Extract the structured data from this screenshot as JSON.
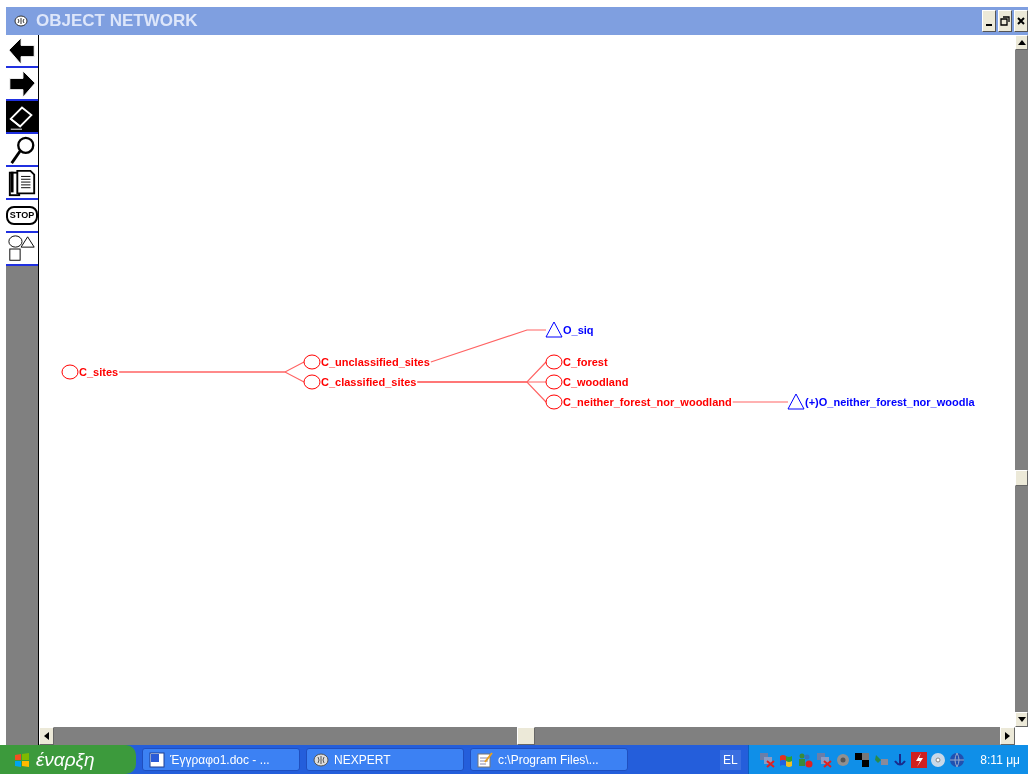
{
  "window": {
    "title": "OBJECT NETWORK"
  },
  "tools": [
    {
      "kind": "back",
      "selected": false
    },
    {
      "kind": "forward",
      "selected": false
    },
    {
      "kind": "eraser",
      "selected": true
    },
    {
      "kind": "magnifier",
      "selected": false
    },
    {
      "kind": "notes",
      "selected": false
    },
    {
      "kind": "stop",
      "label": "STOP",
      "selected": false
    },
    {
      "kind": "shapes",
      "selected": false
    }
  ],
  "network": {
    "root": {
      "kind": "class",
      "label": "C_sites",
      "children": [
        {
          "kind": "class",
          "label": "C_unclassified_sites",
          "children": [
            {
              "kind": "object",
              "label": "O_siq"
            }
          ]
        },
        {
          "kind": "class",
          "label": "C_classified_sites",
          "children": [
            {
              "kind": "class",
              "label": "C_forest"
            },
            {
              "kind": "class",
              "label": "C_woodland"
            },
            {
              "kind": "class",
              "label": "C_neither_forest_nor_woodland",
              "children": [
                {
                  "kind": "object",
                  "label": "(+)O_neither_forest_nor_woodla"
                }
              ]
            }
          ]
        }
      ]
    }
  },
  "taskbar": {
    "start": "έναρξη",
    "tasks": [
      {
        "kind": "word",
        "label": "Έγγραφο1.doc - ..."
      },
      {
        "kind": "app",
        "label": "NEXPERT"
      },
      {
        "kind": "notepad",
        "label": "c:\\Program Files\\..."
      }
    ],
    "language": "EL",
    "time": "8:11 μμ"
  }
}
